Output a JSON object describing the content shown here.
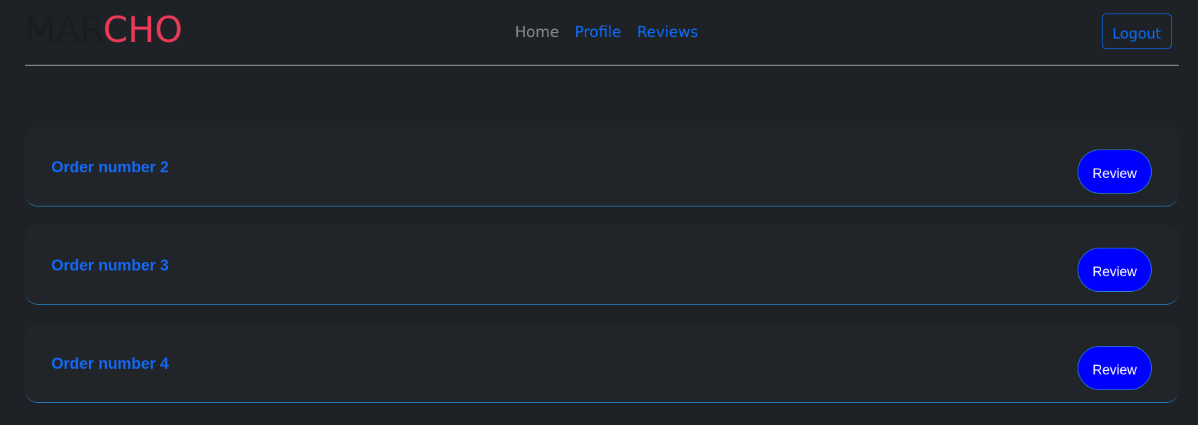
{
  "header": {
    "logo": {
      "part1": "MAR",
      "part2": "CHO"
    },
    "nav": [
      {
        "label": "Home",
        "state": "muted"
      },
      {
        "label": "Profile",
        "state": "active"
      },
      {
        "label": "Reviews",
        "state": "active"
      }
    ],
    "logout_label": "Logout"
  },
  "orders": [
    {
      "title": "Order number 2",
      "button_label": "Review"
    },
    {
      "title": "Order number 3",
      "button_label": "Review"
    },
    {
      "title": "Order number 4",
      "button_label": "Review"
    }
  ],
  "colors": {
    "background": "#1e2126",
    "card": "#212429",
    "accent_blue": "#0d6efd",
    "review_button": "#0000ff",
    "logo_red": "#ec3a57"
  }
}
